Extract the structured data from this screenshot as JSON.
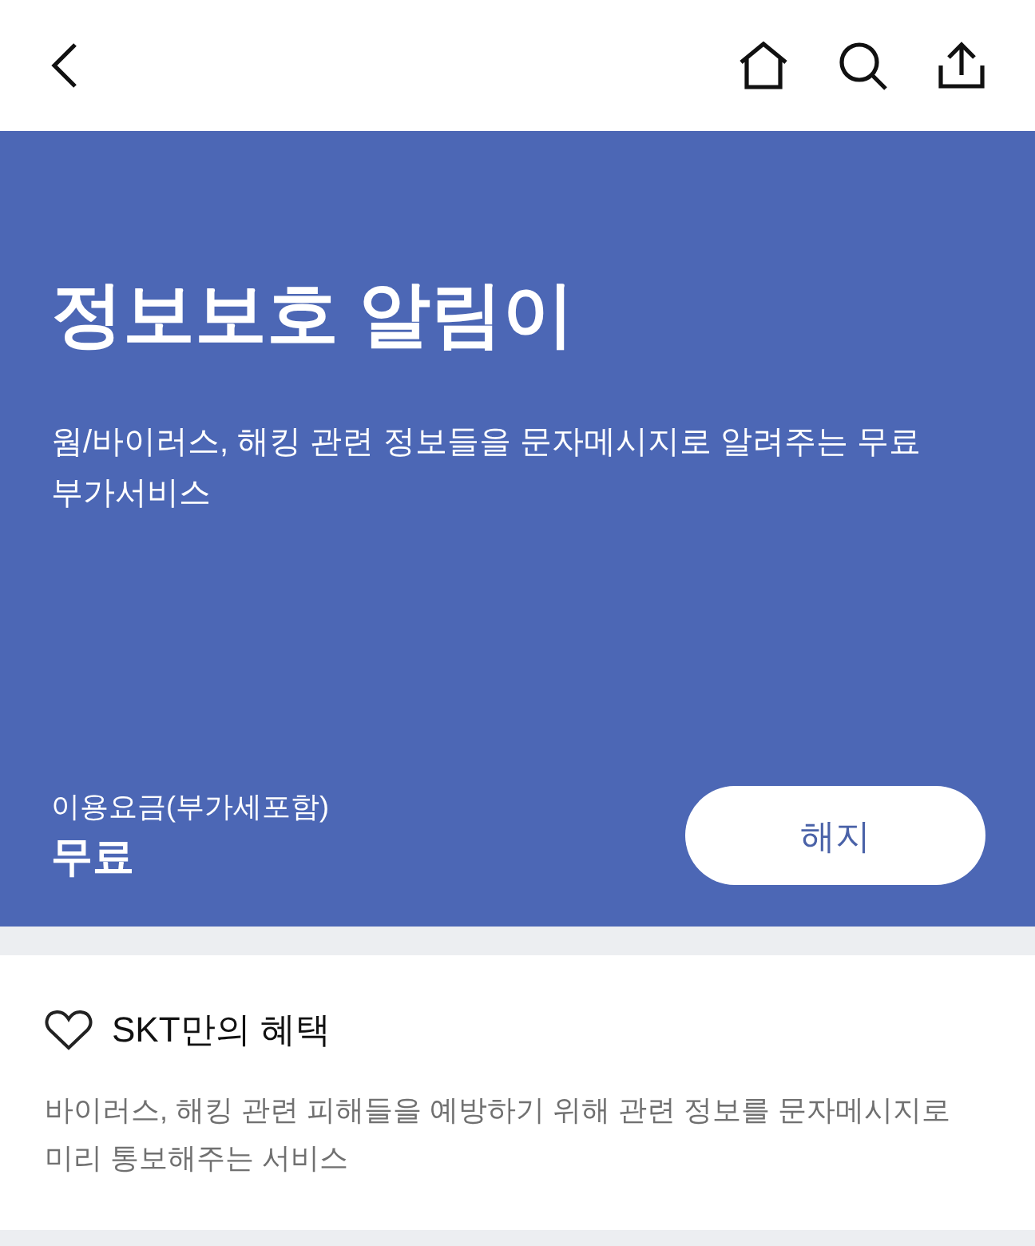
{
  "service": {
    "title": "정보보호 알림이",
    "description": "웜/바이러스, 해킹 관련 정보들을 문자메시지로 알려주는 무료 부가서비스",
    "fee_label": "이용요금(부가세포함)",
    "fee": "무료",
    "action_button": "해지"
  },
  "benefit": {
    "title": "SKT만의 혜택",
    "description": "바이러스, 해킹 관련 피해들을 예방하기 위해 관련 정보를 문자메시지로 미리 통보해주는 서비스"
  }
}
